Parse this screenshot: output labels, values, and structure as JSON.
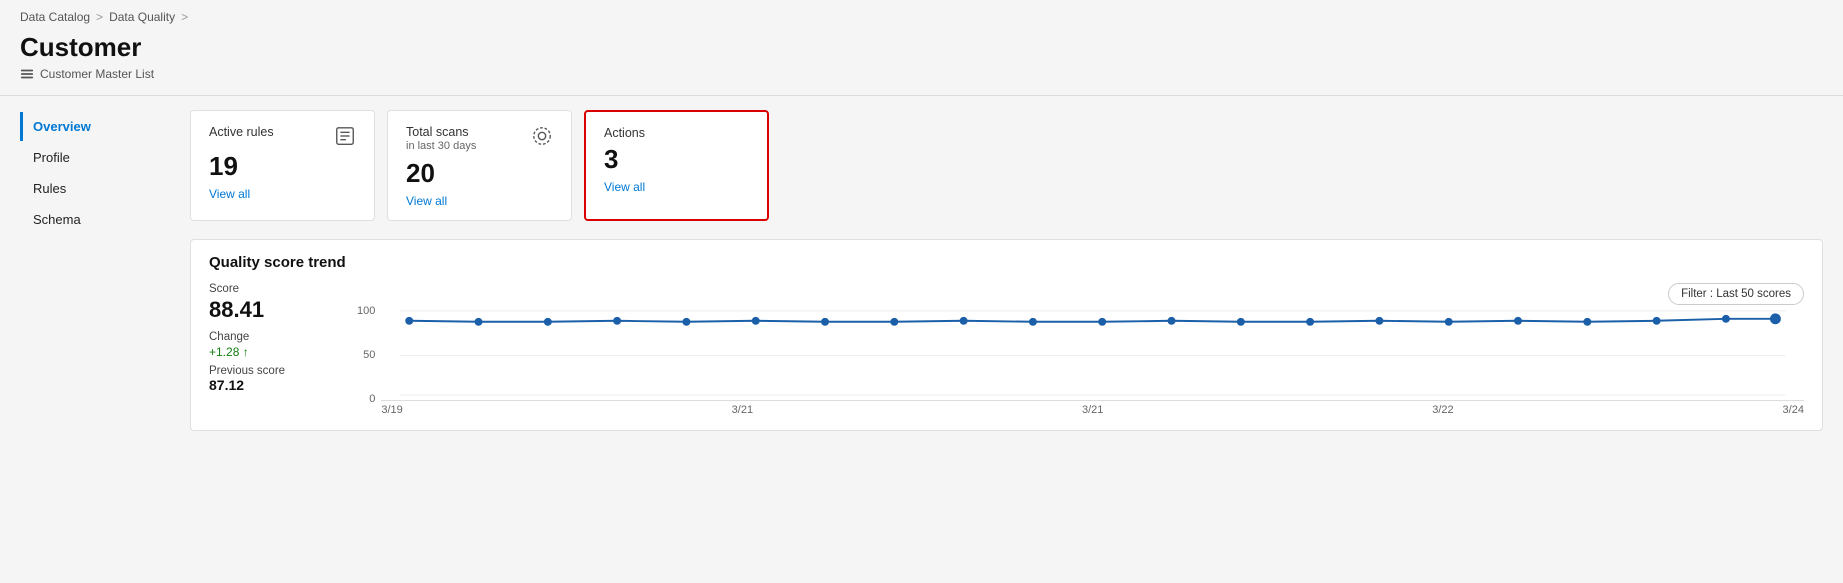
{
  "breadcrumb": {
    "items": [
      "Data Catalog",
      "Data Quality"
    ]
  },
  "header": {
    "title": "Customer",
    "subtitle": "Customer Master List",
    "subtitle_icon": "list-icon"
  },
  "sidebar": {
    "items": [
      {
        "label": "Overview",
        "active": true
      },
      {
        "label": "Profile",
        "active": false
      },
      {
        "label": "Rules",
        "active": false
      },
      {
        "label": "Schema",
        "active": false
      }
    ]
  },
  "cards": [
    {
      "label": "Active rules",
      "sublabel": "",
      "value": "19",
      "link": "View all",
      "highlighted": false,
      "has_icon": true,
      "icon_type": "rules-icon"
    },
    {
      "label": "Total scans",
      "sublabel": "in last 30 days",
      "value": "20",
      "link": "View all",
      "highlighted": false,
      "has_icon": true,
      "icon_type": "scan-icon"
    },
    {
      "label": "Actions",
      "sublabel": "",
      "value": "3",
      "link": "View all",
      "highlighted": true,
      "has_icon": false,
      "icon_type": ""
    }
  ],
  "quality_trend": {
    "title": "Quality score trend",
    "score_label": "Score",
    "score_value": "88.41",
    "change_label": "Change",
    "change_value": "+1.28 ↑",
    "prev_score_label": "Previous score",
    "prev_score_value": "87.12",
    "filter_label": "Filter : Last 50 scores",
    "y_labels": [
      "100",
      "50",
      "0"
    ],
    "x_labels": [
      "3/19",
      "3/21",
      "3/21",
      "3/22",
      "3/24"
    ]
  }
}
